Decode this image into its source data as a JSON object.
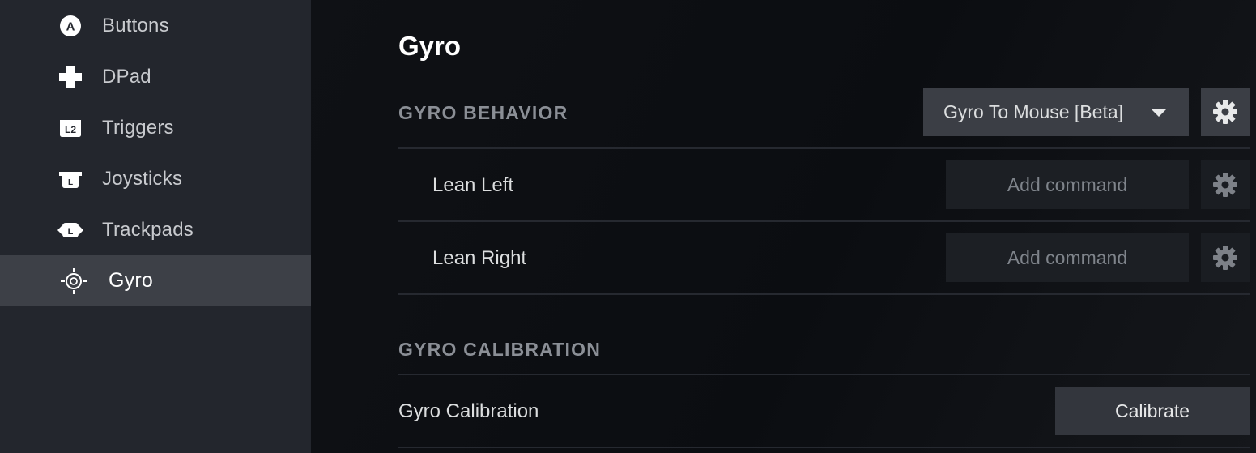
{
  "sidebar": {
    "items": [
      {
        "label": "Buttons",
        "icon": "a-button-icon"
      },
      {
        "label": "DPad",
        "icon": "dpad-icon"
      },
      {
        "label": "Triggers",
        "icon": "l2-trigger-icon"
      },
      {
        "label": "Joysticks",
        "icon": "joystick-icon"
      },
      {
        "label": "Trackpads",
        "icon": "trackpad-icon"
      },
      {
        "label": "Gyro",
        "icon": "gyro-icon",
        "active": true
      }
    ]
  },
  "main": {
    "title": "Gyro",
    "behavior": {
      "section_title": "GYRO BEHAVIOR",
      "mode_value": "Gyro To Mouse [Beta]",
      "rows": [
        {
          "label": "Lean Left",
          "command": "Add command"
        },
        {
          "label": "Lean Right",
          "command": "Add command"
        }
      ]
    },
    "calibration": {
      "section_title": "GYRO CALIBRATION",
      "row_label": "Gyro Calibration",
      "button_label": "Calibrate"
    }
  },
  "colors": {
    "sidebar_bg": "#23262d",
    "sidebar_active": "#3d4047",
    "main_bg": "#0e1014",
    "button_bg": "#3b3e45"
  }
}
